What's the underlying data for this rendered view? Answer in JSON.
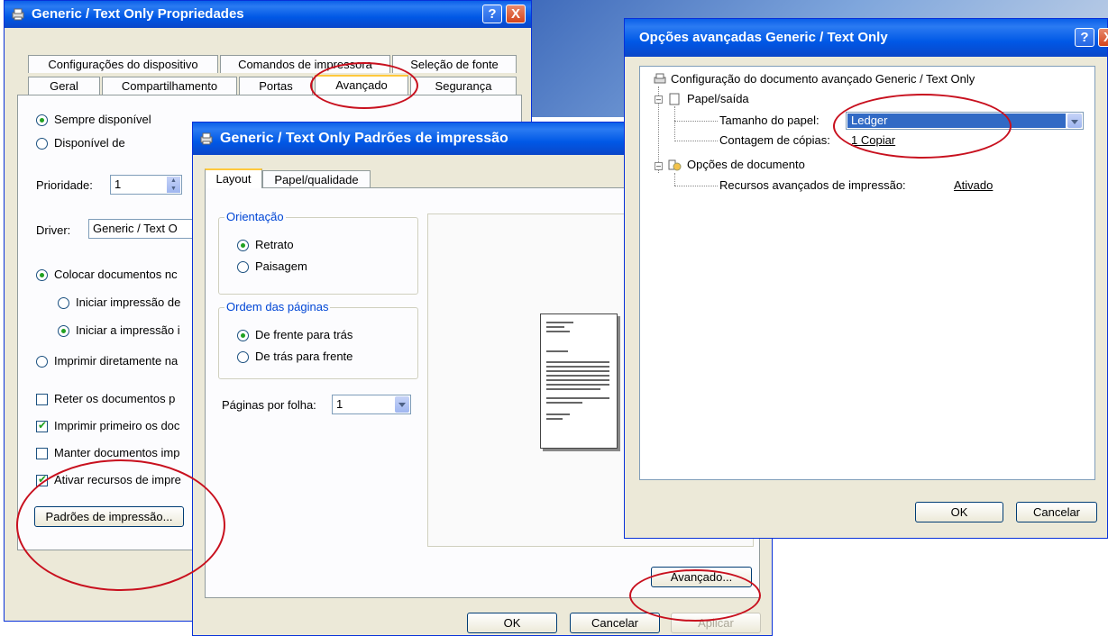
{
  "colors": {
    "xp_blue": "#0058e6",
    "window_bg": "#ece9d8",
    "highlight_red": "#c8101e",
    "selection": "#316ac5"
  },
  "props": {
    "title": "Generic / Text Only Propriedades",
    "tabs_row1": [
      "Configurações do dispositivo",
      "Comandos de impressora",
      "Seleção de fonte"
    ],
    "tabs_row2": [
      "Geral",
      "Compartilhamento",
      "Portas",
      "Avançado",
      "Segurança"
    ],
    "always_available": "Sempre disponível",
    "available_from": "Disponível de",
    "priority_label": "Prioridade:",
    "priority_value": "1",
    "driver_label": "Driver:",
    "driver_value": "Generic / Text O",
    "spool": "Colocar documentos nc",
    "start_after_last": "Iniciar impressão de",
    "start_immediately": "Iniciar a impressão i",
    "print_direct": "Imprimir diretamente na",
    "hold_mismatched": "Reter os documentos p",
    "print_spooled_first": "Imprimir primeiro os doc",
    "keep_printed": "Manter documentos imp",
    "enable_advanced": "Ativar recursos de impre",
    "defaults_button": "Padrões de impressão..."
  },
  "defaults": {
    "title": "Generic / Text Only Padrões de impressão",
    "tabs": [
      "Layout",
      "Papel/qualidade"
    ],
    "orientation_group": "Orientação",
    "portrait": "Retrato",
    "landscape": "Paisagem",
    "page_order_group": "Ordem das páginas",
    "front_to_back": "De frente para trás",
    "back_to_front": "De trás para frente",
    "pages_per_sheet_label": "Páginas por folha:",
    "pages_per_sheet_value": "1",
    "advanced_button": "Avançado...",
    "ok": "OK",
    "cancel": "Cancelar",
    "apply": "Aplicar"
  },
  "advanced": {
    "title": "Opções avançadas Generic / Text Only",
    "root": "Configuração do documento avançado Generic / Text Only",
    "paper_output": "Papel/saída",
    "paper_size_label": "Tamanho do papel:",
    "paper_size_value": "Ledger",
    "copy_count_label": "Contagem de cópias:",
    "copy_count_value": "1 Copiar",
    "document_options": "Opções de documento",
    "advanced_features_label": "Recursos avançados de impressão:",
    "advanced_features_value": "Ativado",
    "ok": "OK",
    "cancel": "Cancelar"
  },
  "window_buttons": {
    "help": "?",
    "close": "X"
  }
}
